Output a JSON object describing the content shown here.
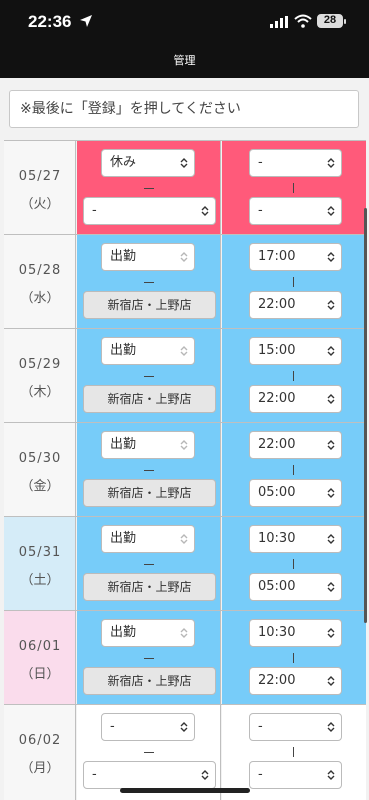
{
  "status": {
    "time": "22:36",
    "battery": "28"
  },
  "navbar": {
    "title": "管理"
  },
  "notice": {
    "text": "※最後に「登録」を押してください"
  },
  "colors": {
    "off": "#ff5a7a",
    "work": "#77ccf9",
    "saturday": "#d5ecf8",
    "sunday": "#fadcec",
    "empty": "#f7f7f7"
  },
  "rows": [
    {
      "date": "05/27",
      "weekday": "（火）",
      "status": "休み",
      "store": "-",
      "start": "-",
      "end": "-",
      "kind": "off"
    },
    {
      "date": "05/28",
      "weekday": "（水）",
      "status": "出勤",
      "store": "新宿店・上野店",
      "start": "17:00",
      "end": "22:00",
      "kind": "work"
    },
    {
      "date": "05/29",
      "weekday": "（木）",
      "status": "出勤",
      "store": "新宿店・上野店",
      "start": "15:00",
      "end": "22:00",
      "kind": "work"
    },
    {
      "date": "05/30",
      "weekday": "（金）",
      "status": "出勤",
      "store": "新宿店・上野店",
      "start": "22:00",
      "end": "05:00",
      "kind": "work"
    },
    {
      "date": "05/31",
      "weekday": "（土）",
      "status": "出勤",
      "store": "新宿店・上野店",
      "start": "10:30",
      "end": "05:00",
      "kind": "work",
      "dayclass": "saturday"
    },
    {
      "date": "06/01",
      "weekday": "（日）",
      "status": "出勤",
      "store": "新宿店・上野店",
      "start": "10:30",
      "end": "22:00",
      "kind": "work",
      "dayclass": "sunday"
    },
    {
      "date": "06/02",
      "weekday": "（月）",
      "status": "-",
      "store": "-",
      "start": "-",
      "end": "-",
      "kind": "empty"
    }
  ]
}
